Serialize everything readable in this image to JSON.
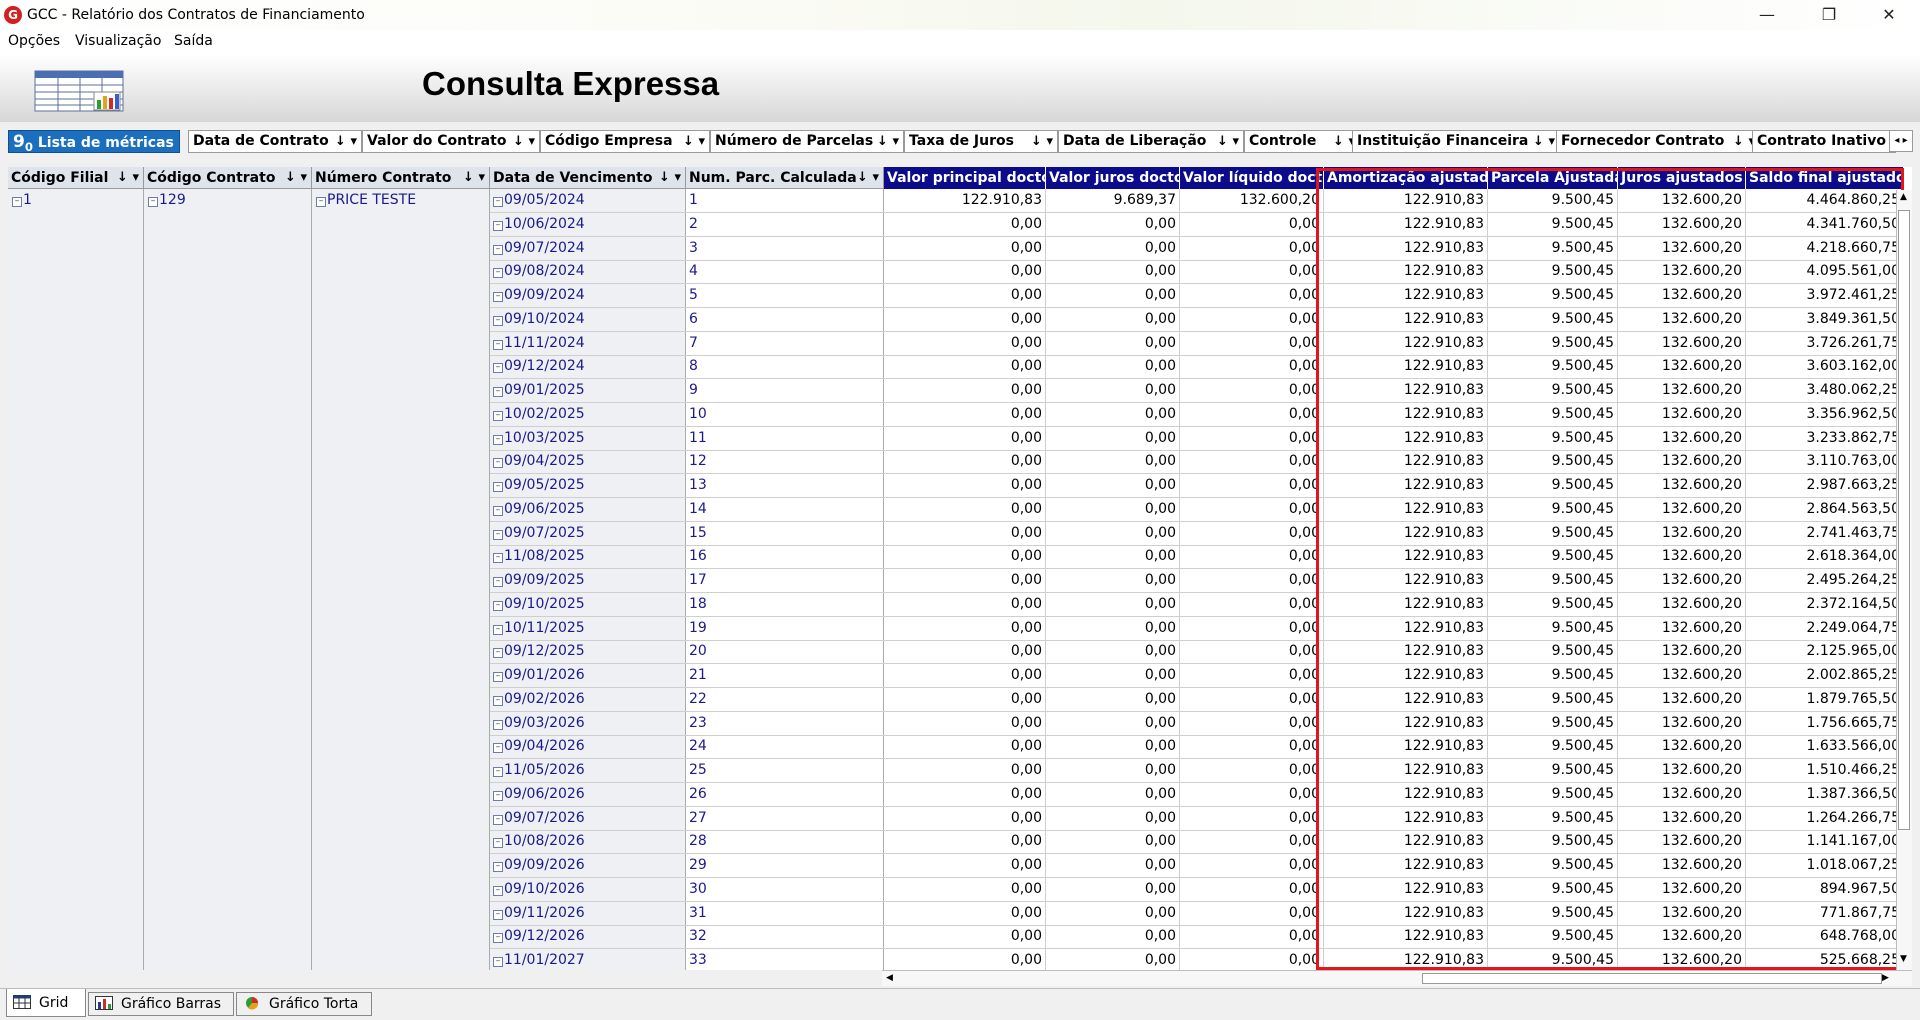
{
  "window": {
    "title": "GCC - Relatório dos Contratos de Financiamento",
    "app_icon_letter": "G",
    "controls": {
      "minimize": "—",
      "restore": "❐",
      "close": "✕"
    }
  },
  "menu": [
    "Opções",
    "Visualização",
    "Saída"
  ],
  "page_title": "Consulta Expressa",
  "field_bar": {
    "metrics_prefix": "9",
    "metrics_subscript": "0",
    "metrics_label": "Lista de métricas",
    "fields": [
      "Data de Contrato",
      "Valor do Contrato",
      "Código Empresa",
      "Número de Parcelas",
      "Taxa de Juros",
      "Data de Liberação",
      "Controle",
      "Instituição Financeira",
      "Fornecedor Contrato",
      "Contrato Inativo"
    ],
    "chip_arrows": "↓ ▾",
    "scroll_left": "◂",
    "scroll_right": "▸"
  },
  "grid": {
    "dim_headers": [
      "Código Filial",
      "Código Contrato",
      "Número Contrato",
      "Data de Vencimento",
      "Num. Parc. Calculada"
    ],
    "header_arrows": "↓ ▾",
    "metric_headers": [
      "Valor principal docto",
      "Valor juros docto",
      "Valor líquido docto",
      "Amortização ajustada",
      "Parcela Ajustada",
      "Juros ajustados",
      "Saldo final ajustado"
    ],
    "codigo_filial": "1",
    "codigo_contrato": "129",
    "numero_contrato": "PRICE TESTE",
    "expand_symbol": "⊟",
    "rows": [
      {
        "date": "09/05/2024",
        "parc": "1",
        "vp": "122.910,83",
        "vj": "9.689,37",
        "vl": "132.600,20",
        "amort": "122.910,83",
        "parcela": "9.500,45",
        "juros": "132.600,20",
        "saldo": "4.464.860,25"
      },
      {
        "date": "10/06/2024",
        "parc": "2",
        "vp": "0,00",
        "vj": "0,00",
        "vl": "0,00",
        "amort": "122.910,83",
        "parcela": "9.500,45",
        "juros": "132.600,20",
        "saldo": "4.341.760,50"
      },
      {
        "date": "09/07/2024",
        "parc": "3",
        "vp": "0,00",
        "vj": "0,00",
        "vl": "0,00",
        "amort": "122.910,83",
        "parcela": "9.500,45",
        "juros": "132.600,20",
        "saldo": "4.218.660,75"
      },
      {
        "date": "09/08/2024",
        "parc": "4",
        "vp": "0,00",
        "vj": "0,00",
        "vl": "0,00",
        "amort": "122.910,83",
        "parcela": "9.500,45",
        "juros": "132.600,20",
        "saldo": "4.095.561,00"
      },
      {
        "date": "09/09/2024",
        "parc": "5",
        "vp": "0,00",
        "vj": "0,00",
        "vl": "0,00",
        "amort": "122.910,83",
        "parcela": "9.500,45",
        "juros": "132.600,20",
        "saldo": "3.972.461,25"
      },
      {
        "date": "09/10/2024",
        "parc": "6",
        "vp": "0,00",
        "vj": "0,00",
        "vl": "0,00",
        "amort": "122.910,83",
        "parcela": "9.500,45",
        "juros": "132.600,20",
        "saldo": "3.849.361,50"
      },
      {
        "date": "11/11/2024",
        "parc": "7",
        "vp": "0,00",
        "vj": "0,00",
        "vl": "0,00",
        "amort": "122.910,83",
        "parcela": "9.500,45",
        "juros": "132.600,20",
        "saldo": "3.726.261,75"
      },
      {
        "date": "09/12/2024",
        "parc": "8",
        "vp": "0,00",
        "vj": "0,00",
        "vl": "0,00",
        "amort": "122.910,83",
        "parcela": "9.500,45",
        "juros": "132.600,20",
        "saldo": "3.603.162,00"
      },
      {
        "date": "09/01/2025",
        "parc": "9",
        "vp": "0,00",
        "vj": "0,00",
        "vl": "0,00",
        "amort": "122.910,83",
        "parcela": "9.500,45",
        "juros": "132.600,20",
        "saldo": "3.480.062,25"
      },
      {
        "date": "10/02/2025",
        "parc": "10",
        "vp": "0,00",
        "vj": "0,00",
        "vl": "0,00",
        "amort": "122.910,83",
        "parcela": "9.500,45",
        "juros": "132.600,20",
        "saldo": "3.356.962,50"
      },
      {
        "date": "10/03/2025",
        "parc": "11",
        "vp": "0,00",
        "vj": "0,00",
        "vl": "0,00",
        "amort": "122.910,83",
        "parcela": "9.500,45",
        "juros": "132.600,20",
        "saldo": "3.233.862,75"
      },
      {
        "date": "09/04/2025",
        "parc": "12",
        "vp": "0,00",
        "vj": "0,00",
        "vl": "0,00",
        "amort": "122.910,83",
        "parcela": "9.500,45",
        "juros": "132.600,20",
        "saldo": "3.110.763,00"
      },
      {
        "date": "09/05/2025",
        "parc": "13",
        "vp": "0,00",
        "vj": "0,00",
        "vl": "0,00",
        "amort": "122.910,83",
        "parcela": "9.500,45",
        "juros": "132.600,20",
        "saldo": "2.987.663,25"
      },
      {
        "date": "09/06/2025",
        "parc": "14",
        "vp": "0,00",
        "vj": "0,00",
        "vl": "0,00",
        "amort": "122.910,83",
        "parcela": "9.500,45",
        "juros": "132.600,20",
        "saldo": "2.864.563,50"
      },
      {
        "date": "09/07/2025",
        "parc": "15",
        "vp": "0,00",
        "vj": "0,00",
        "vl": "0,00",
        "amort": "122.910,83",
        "parcela": "9.500,45",
        "juros": "132.600,20",
        "saldo": "2.741.463,75"
      },
      {
        "date": "11/08/2025",
        "parc": "16",
        "vp": "0,00",
        "vj": "0,00",
        "vl": "0,00",
        "amort": "122.910,83",
        "parcela": "9.500,45",
        "juros": "132.600,20",
        "saldo": "2.618.364,00"
      },
      {
        "date": "09/09/2025",
        "parc": "17",
        "vp": "0,00",
        "vj": "0,00",
        "vl": "0,00",
        "amort": "122.910,83",
        "parcela": "9.500,45",
        "juros": "132.600,20",
        "saldo": "2.495.264,25"
      },
      {
        "date": "09/10/2025",
        "parc": "18",
        "vp": "0,00",
        "vj": "0,00",
        "vl": "0,00",
        "amort": "122.910,83",
        "parcela": "9.500,45",
        "juros": "132.600,20",
        "saldo": "2.372.164,50"
      },
      {
        "date": "10/11/2025",
        "parc": "19",
        "vp": "0,00",
        "vj": "0,00",
        "vl": "0,00",
        "amort": "122.910,83",
        "parcela": "9.500,45",
        "juros": "132.600,20",
        "saldo": "2.249.064,75"
      },
      {
        "date": "09/12/2025",
        "parc": "20",
        "vp": "0,00",
        "vj": "0,00",
        "vl": "0,00",
        "amort": "122.910,83",
        "parcela": "9.500,45",
        "juros": "132.600,20",
        "saldo": "2.125.965,00"
      },
      {
        "date": "09/01/2026",
        "parc": "21",
        "vp": "0,00",
        "vj": "0,00",
        "vl": "0,00",
        "amort": "122.910,83",
        "parcela": "9.500,45",
        "juros": "132.600,20",
        "saldo": "2.002.865,25"
      },
      {
        "date": "09/02/2026",
        "parc": "22",
        "vp": "0,00",
        "vj": "0,00",
        "vl": "0,00",
        "amort": "122.910,83",
        "parcela": "9.500,45",
        "juros": "132.600,20",
        "saldo": "1.879.765,50"
      },
      {
        "date": "09/03/2026",
        "parc": "23",
        "vp": "0,00",
        "vj": "0,00",
        "vl": "0,00",
        "amort": "122.910,83",
        "parcela": "9.500,45",
        "juros": "132.600,20",
        "saldo": "1.756.665,75"
      },
      {
        "date": "09/04/2026",
        "parc": "24",
        "vp": "0,00",
        "vj": "0,00",
        "vl": "0,00",
        "amort": "122.910,83",
        "parcela": "9.500,45",
        "juros": "132.600,20",
        "saldo": "1.633.566,00"
      },
      {
        "date": "11/05/2026",
        "parc": "25",
        "vp": "0,00",
        "vj": "0,00",
        "vl": "0,00",
        "amort": "122.910,83",
        "parcela": "9.500,45",
        "juros": "132.600,20",
        "saldo": "1.510.466,25"
      },
      {
        "date": "09/06/2026",
        "parc": "26",
        "vp": "0,00",
        "vj": "0,00",
        "vl": "0,00",
        "amort": "122.910,83",
        "parcela": "9.500,45",
        "juros": "132.600,20",
        "saldo": "1.387.366,50"
      },
      {
        "date": "09/07/2026",
        "parc": "27",
        "vp": "0,00",
        "vj": "0,00",
        "vl": "0,00",
        "amort": "122.910,83",
        "parcela": "9.500,45",
        "juros": "132.600,20",
        "saldo": "1.264.266,75"
      },
      {
        "date": "10/08/2026",
        "parc": "28",
        "vp": "0,00",
        "vj": "0,00",
        "vl": "0,00",
        "amort": "122.910,83",
        "parcela": "9.500,45",
        "juros": "132.600,20",
        "saldo": "1.141.167,00"
      },
      {
        "date": "09/09/2026",
        "parc": "29",
        "vp": "0,00",
        "vj": "0,00",
        "vl": "0,00",
        "amort": "122.910,83",
        "parcela": "9.500,45",
        "juros": "132.600,20",
        "saldo": "1.018.067,25"
      },
      {
        "date": "09/10/2026",
        "parc": "30",
        "vp": "0,00",
        "vj": "0,00",
        "vl": "0,00",
        "amort": "122.910,83",
        "parcela": "9.500,45",
        "juros": "132.600,20",
        "saldo": "894.967,50"
      },
      {
        "date": "09/11/2026",
        "parc": "31",
        "vp": "0,00",
        "vj": "0,00",
        "vl": "0,00",
        "amort": "122.910,83",
        "parcela": "9.500,45",
        "juros": "132.600,20",
        "saldo": "771.867,75"
      },
      {
        "date": "09/12/2026",
        "parc": "32",
        "vp": "0,00",
        "vj": "0,00",
        "vl": "0,00",
        "amort": "122.910,83",
        "parcela": "9.500,45",
        "juros": "132.600,20",
        "saldo": "648.768,00"
      },
      {
        "date": "11/01/2027",
        "parc": "33",
        "vp": "0,00",
        "vj": "0,00",
        "vl": "0,00",
        "amort": "122.910,83",
        "parcela": "9.500,45",
        "juros": "132.600,20",
        "saldo": "525.668,25"
      }
    ]
  },
  "scroll_arrows": {
    "up": "▲",
    "down": "▼",
    "left": "◀",
    "right": "▶"
  },
  "tabs": [
    "Grid",
    "Gráfico Barras",
    "Gráfico Torta"
  ],
  "colors": {
    "metric_header_bg": "#0b0b8b",
    "metrics_button_bg": "#1c6fbe",
    "highlight_border": "#e3151a",
    "dim_text": "#1a1a8c"
  }
}
